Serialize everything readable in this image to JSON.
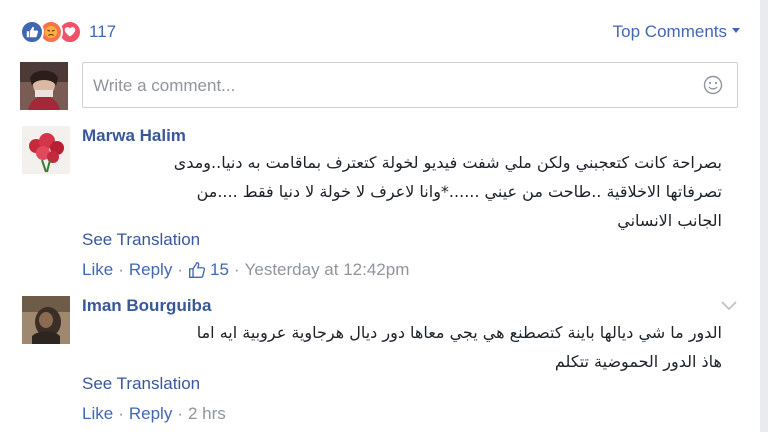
{
  "reactions": {
    "count": "117",
    "icons": [
      "like-icon",
      "angry-icon",
      "love-icon"
    ],
    "colors": {
      "like": "#4267b2",
      "angry": "#f7714c",
      "love": "#f25268"
    }
  },
  "sort": {
    "label": "Top Comments"
  },
  "composer": {
    "placeholder": "Write a comment..."
  },
  "comments": [
    {
      "author": "Marwa Halim",
      "lines": [
        "بصراحة كانت كتعجبني ولكن ملي شفت فيديو لخولة كتعترف بماقامت به دنيا..ومدى",
        "تصرفاتها الاخلاقية ..طاحت من عيني ......*وانا لاعرف لا خولة لا دنيا فقط ....من",
        "الجانب الانساني"
      ],
      "see_translation": "See Translation",
      "like": "Like",
      "reply": "Reply",
      "likes_count": "15",
      "time": "Yesterday at 12:42pm"
    },
    {
      "author": "Iman Bourguiba",
      "lines": [
        "الدور ما شي ديالها باينة كتصطنع هي يجي معاها دور ديال هرجاوية عروبية ايه اما",
        "هاذ الدور الحموضية تتكلم"
      ],
      "see_translation": "See Translation",
      "like": "Like",
      "reply": "Reply",
      "time": "2 hrs"
    }
  ]
}
